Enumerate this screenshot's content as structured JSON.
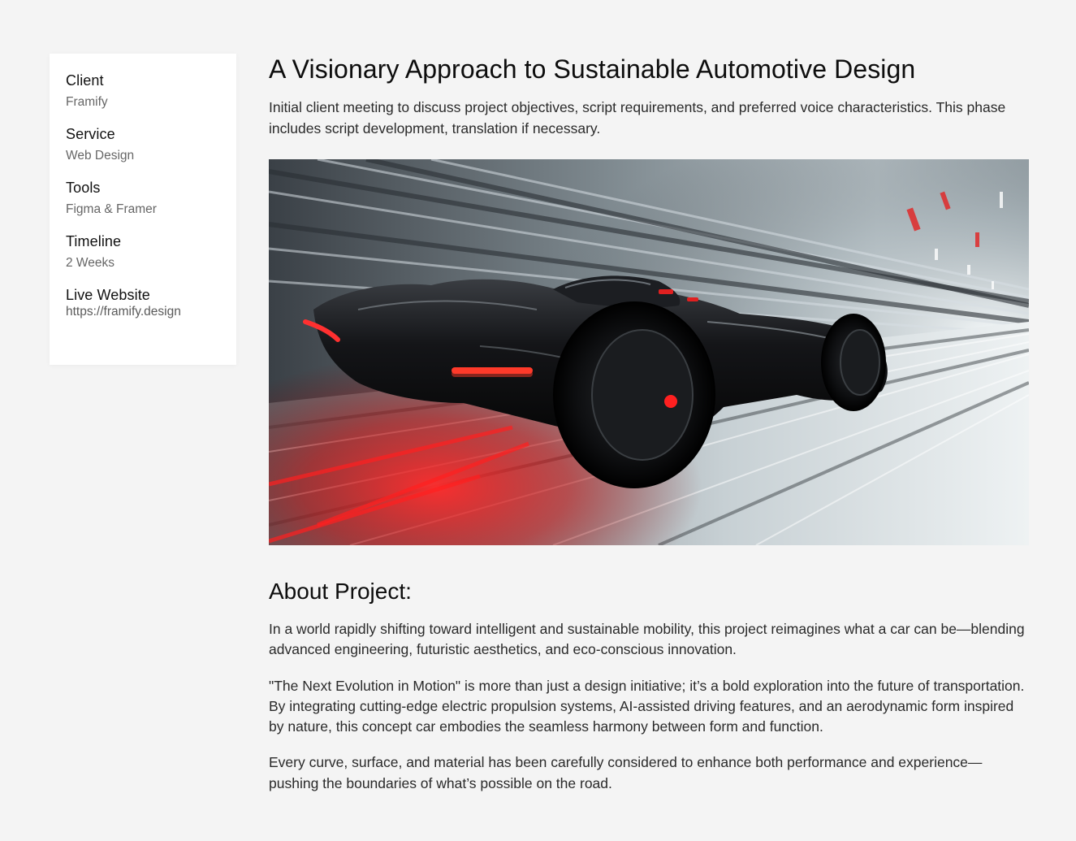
{
  "sidebar": {
    "items": [
      {
        "label": "Client",
        "value": "Framify"
      },
      {
        "label": "Service",
        "value": "Web Design"
      },
      {
        "label": "Tools",
        "value": "Figma & Framer"
      },
      {
        "label": "Timeline",
        "value": "2 Weeks"
      },
      {
        "label": "Live Website",
        "value": "https://framify.design"
      }
    ]
  },
  "main": {
    "title": "A Visionary Approach to Sustainable Automotive Design",
    "intro": "Initial client meeting to discuss project objectives, script requirements, and preferred voice characteristics. This phase includes script development, translation if necessary.",
    "hero_image": "futuristic-black-race-car-in-tunnel",
    "about": {
      "heading": "About Project:",
      "paragraphs": [
        "In a world rapidly shifting toward intelligent and sustainable mobility, this project reimagines what a car can be—blending advanced engineering, futuristic aesthetics, and eco-conscious innovation.",
        "\"The Next Evolution in Motion\" is more than just a design initiative; it’s a bold exploration into the future of transportation. By integrating cutting-edge electric propulsion systems, AI-assisted driving features, and an aerodynamic form inspired by nature, this concept car embodies the seamless harmony between form and function.",
        "Every curve, surface, and material has been carefully considered to enhance both performance and experience—pushing the boundaries of what’s possible on the road."
      ]
    }
  },
  "colors": {
    "background": "#f4f4f4",
    "card": "#ffffff",
    "text": "#121212",
    "muted": "#666666",
    "accent_red": "#e01818"
  }
}
